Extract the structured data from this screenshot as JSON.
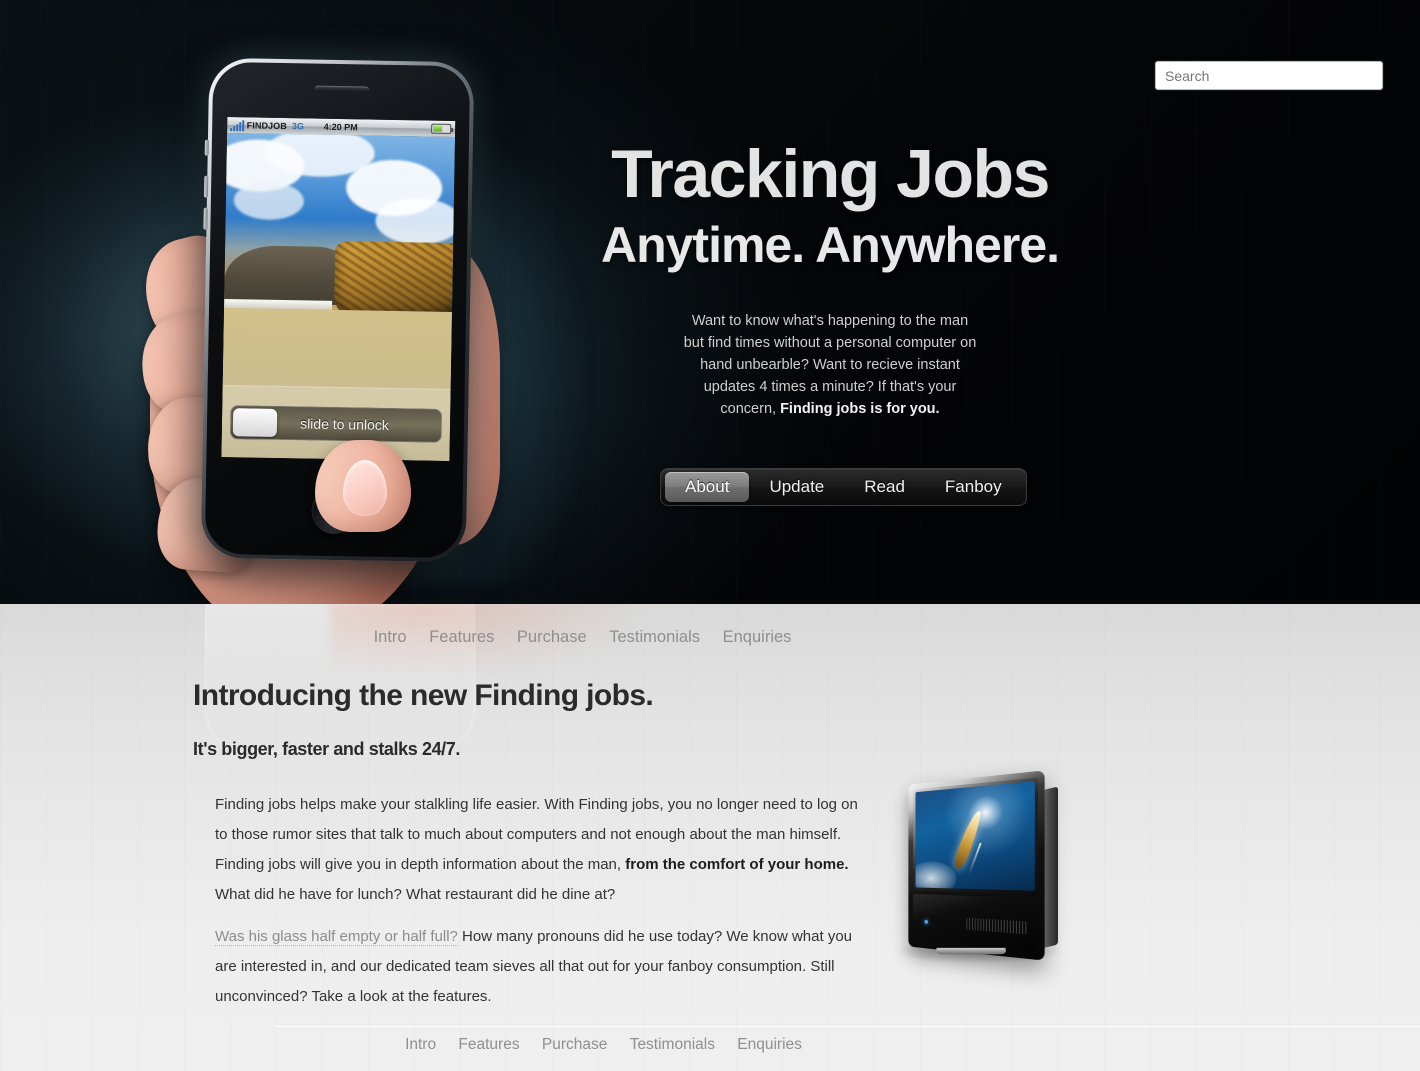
{
  "search": {
    "placeholder": "Search",
    "value": ""
  },
  "hero": {
    "headline": "Tracking Jobs",
    "subheadline": "Anytime. Anywhere.",
    "paragraph": "Want to know what's happening to the man but find times without a personal computer on hand unbearble? Want to recieve instant updates 4 times a minute? If that's your concern, ",
    "paragraph_bold": "Finding jobs is for you.",
    "tabs": [
      {
        "label": "About",
        "active": true
      },
      {
        "label": "Update",
        "active": false
      },
      {
        "label": "Read",
        "active": false
      },
      {
        "label": "Fanboy",
        "active": false
      }
    ]
  },
  "phone": {
    "carrier": "FINDJOB",
    "network": "3G",
    "time": "4:20 PM",
    "slide_label": "slide to unlock"
  },
  "nav": {
    "items": [
      "Intro",
      "Features",
      "Purchase",
      "Testimonials",
      "Enquiries"
    ]
  },
  "main": {
    "heading": "Introducing the new Finding jobs.",
    "subheading": "It's bigger, faster and stalks 24/7.",
    "p1_a": "Finding jobs helps make your stalkling life easier. With Finding jobs, you no longer need to log on to those rumor sites that talk to much about computers and not enough about the man himself. Finding jobs will give you in depth information about the man, ",
    "p1_bold": "from the comfort of your home.",
    "p1_b": " What did he have for lunch? What restaurant did he dine at?",
    "p2_link": "Was his glass half empty or half full?",
    "p2_rest": " How many pronouns did he use today? We know what you are interested in, and our dedicated team sieves all that out for your fanboy consumption. Still unconvinced? Take a look at the features."
  },
  "colors": {
    "hero_bg": "#040507",
    "hero_glow": "#3c5f6e",
    "lower_bg": "#efefef",
    "nav_link": "#8f8f8f",
    "heading": "#2b2b2b",
    "tab_active": "#7d7d7d"
  }
}
